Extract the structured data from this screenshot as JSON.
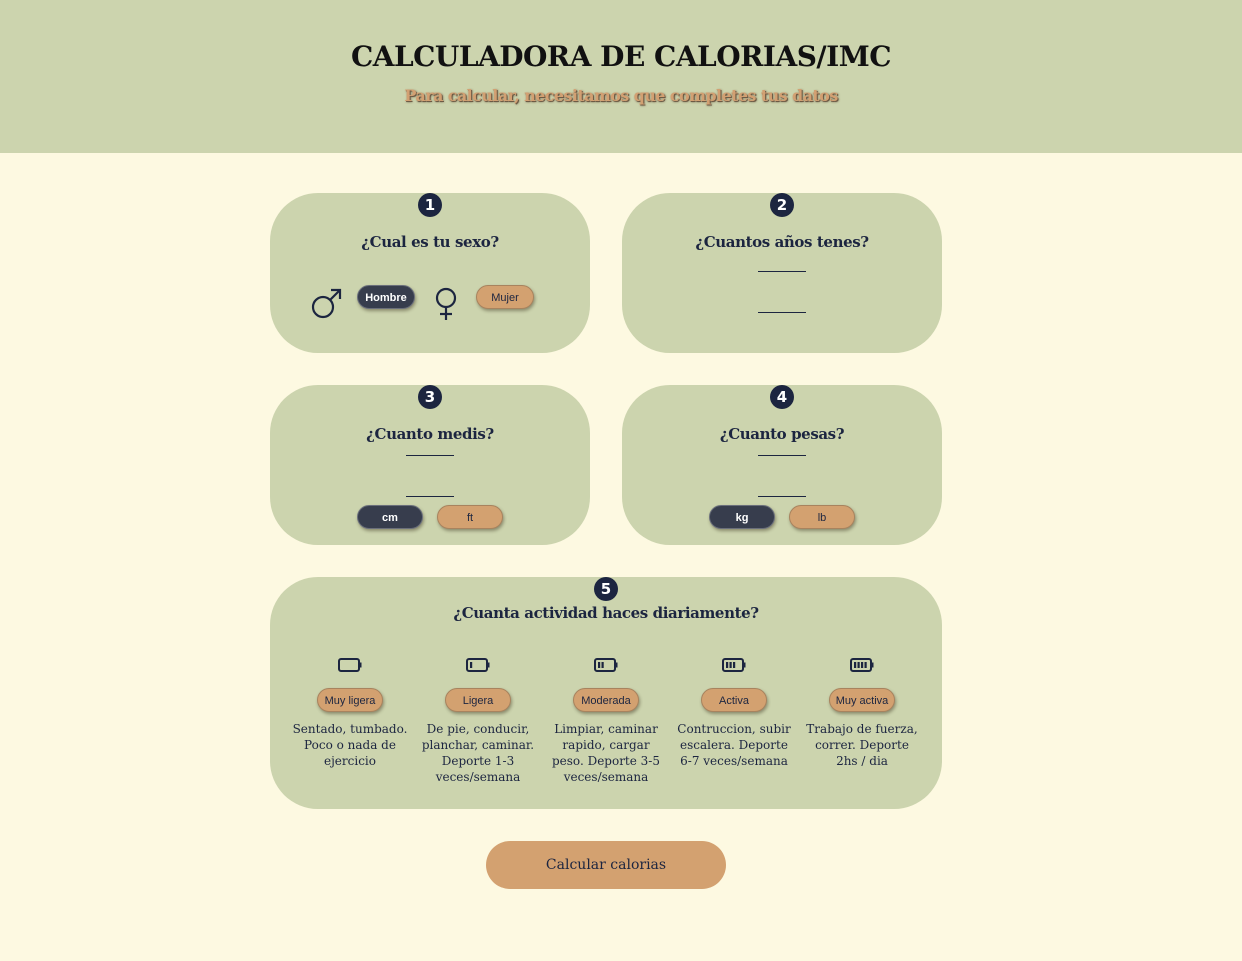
{
  "header": {
    "title": "CALCULADORA DE CALORIAS/IMC",
    "subtitle": "Para calcular, necesitamos que completes tus datos"
  },
  "steps": [
    {
      "number": "1",
      "title": "¿Cual es tu sexo?",
      "options": [
        {
          "icon": "male-symbol-icon",
          "label": "Hombre",
          "selected": true
        },
        {
          "icon": "female-symbol-icon",
          "label": "Mujer",
          "selected": false
        }
      ]
    },
    {
      "number": "2",
      "title": "¿Cuantos años tenes?",
      "inputs": [
        {
          "value": "",
          "placeholder": ""
        },
        {
          "value": "",
          "placeholder": ""
        }
      ]
    },
    {
      "number": "3",
      "title": "¿Cuanto medis?",
      "inputs": [
        {
          "value": "",
          "placeholder": ""
        },
        {
          "value": "",
          "placeholder": ""
        }
      ],
      "units": [
        {
          "label": "cm",
          "selected": true
        },
        {
          "label": "ft",
          "selected": false
        }
      ]
    },
    {
      "number": "4",
      "title": "¿Cuanto pesas?",
      "inputs": [
        {
          "value": "",
          "placeholder": ""
        },
        {
          "value": "",
          "placeholder": ""
        }
      ],
      "units": [
        {
          "label": "kg",
          "selected": true
        },
        {
          "label": "lb",
          "selected": false
        }
      ]
    },
    {
      "number": "5",
      "title": "¿Cuanta actividad haces diariamente?",
      "levels": [
        {
          "icon": "battery-empty-icon",
          "bars": 0,
          "label": "Muy ligera",
          "description": "Sentado, tumbado. Poco o nada de ejercicio"
        },
        {
          "icon": "battery-one-bar-icon",
          "bars": 1,
          "label": "Ligera",
          "description": "De pie, conducir, planchar, caminar. Deporte 1-3 veces/semana"
        },
        {
          "icon": "battery-two-bars-icon",
          "bars": 2,
          "label": "Moderada",
          "description": "Limpiar, caminar rapido, cargar peso. Deporte 3-5 veces/semana"
        },
        {
          "icon": "battery-three-bars-icon",
          "bars": 3,
          "label": "Activa",
          "description": "Contruccion, subir escalera. Deporte 6-7 veces/semana"
        },
        {
          "icon": "battery-full-icon",
          "bars": 4,
          "label": "Muy activa",
          "description": "Trabajo de fuerza, correr. Deporte 2hs / dia"
        }
      ]
    }
  ],
  "submit": {
    "label": "Calcular calorias"
  },
  "colors": {
    "background": "#fdf9e1",
    "card": "#ccd4ae",
    "navy": "#1c2540",
    "selected_pill": "#373d4d",
    "accent_tan": "#d3a170"
  }
}
